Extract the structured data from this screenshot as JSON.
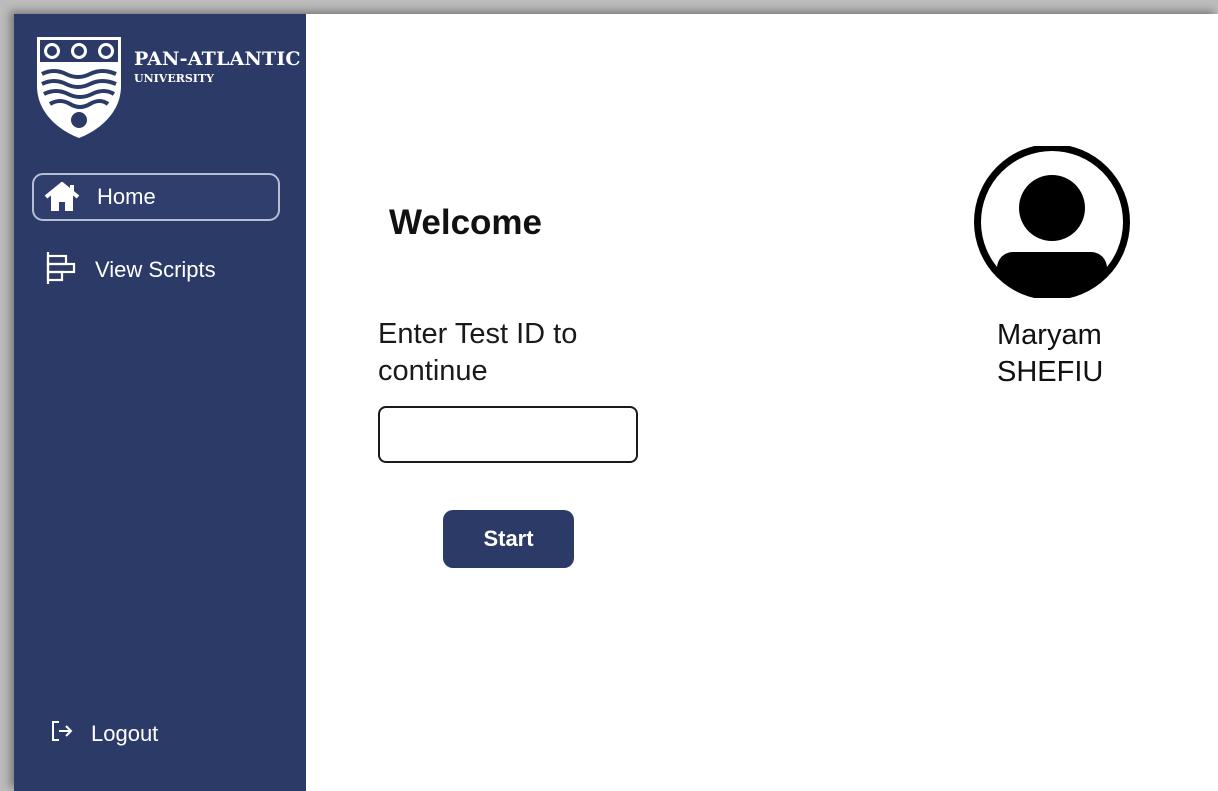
{
  "brand": {
    "name": "PAN-ATLANTIC",
    "subtitle": "UNIVERSITY",
    "primary_color": "#2b3a67"
  },
  "sidebar": {
    "items": [
      {
        "label": "Home",
        "icon": "home-icon",
        "active": true
      },
      {
        "label": "View Scripts",
        "icon": "scripts-icon",
        "active": false
      }
    ],
    "logout": {
      "label": "Logout",
      "icon": "logout-icon"
    }
  },
  "main": {
    "welcome": "Welcome",
    "prompt": "Enter Test ID to continue",
    "test_id": {
      "value": "",
      "placeholder": ""
    },
    "start_label": "Start"
  },
  "user": {
    "first_name": "Maryam",
    "last_name": "SHEFIU",
    "avatar_icon": "user-avatar-icon"
  }
}
